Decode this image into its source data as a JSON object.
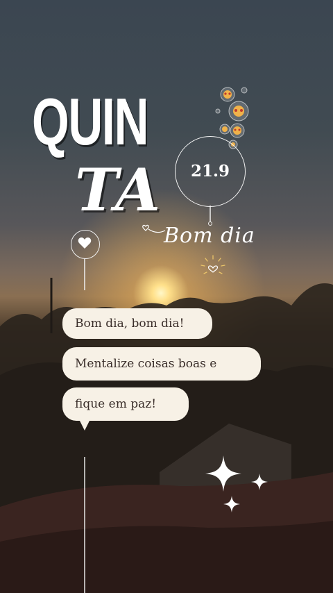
{
  "day": {
    "line1": "QUIN",
    "line2": "TA"
  },
  "date": "21.9",
  "greeting_script": "Bom dia",
  "messages": [
    "Bom dia, bom dia!",
    "Mentalize coisas boas e",
    "fique em paz!"
  ],
  "icons": [
    "heart-icon",
    "emoji-bubbles-decoration",
    "sun-doodle-icon",
    "sparkle-icon"
  ],
  "colors": {
    "bubble": "#f7f1e6",
    "bubble_text": "#3a2e2a",
    "title": "#ffffff"
  }
}
